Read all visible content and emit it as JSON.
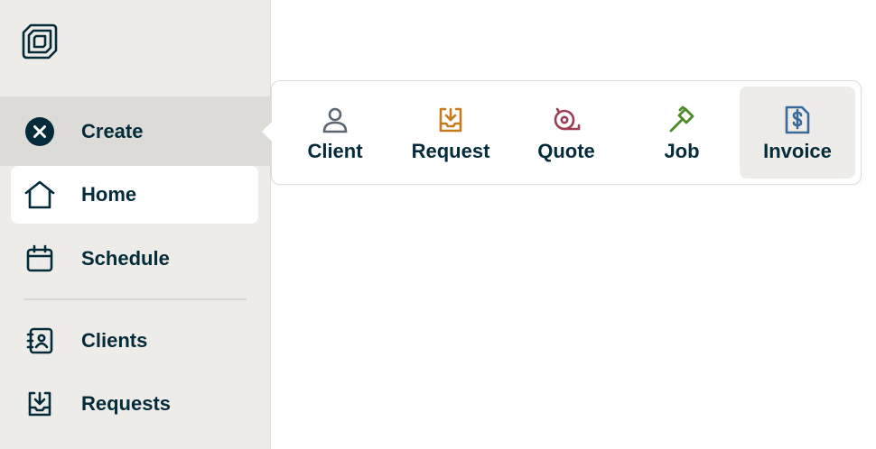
{
  "sidebar": {
    "logo_icon": "jobber-logo-icon",
    "items": [
      {
        "label": "Create",
        "icon": "close-circle-icon"
      },
      {
        "label": "Home",
        "icon": "home-icon"
      },
      {
        "label": "Schedule",
        "icon": "calendar-icon"
      },
      {
        "label": "Clients",
        "icon": "address-book-icon"
      },
      {
        "label": "Requests",
        "icon": "inbox-download-icon"
      }
    ]
  },
  "create_menu": {
    "items": [
      {
        "label": "Client",
        "icon": "person-icon",
        "color": "#5b6670"
      },
      {
        "label": "Request",
        "icon": "inbox-download-icon",
        "color": "#c77a1e"
      },
      {
        "label": "Quote",
        "icon": "measuring-tape-icon",
        "color": "#9b3e54"
      },
      {
        "label": "Job",
        "icon": "hammer-icon",
        "color": "#4d8a2a"
      },
      {
        "label": "Invoice",
        "icon": "invoice-dollar-icon",
        "color": "#3a6a9a"
      }
    ]
  },
  "colors": {
    "text": "#032b3a",
    "sidebar_bg": "#eeece8",
    "active_bg": "#dcdbd7"
  }
}
